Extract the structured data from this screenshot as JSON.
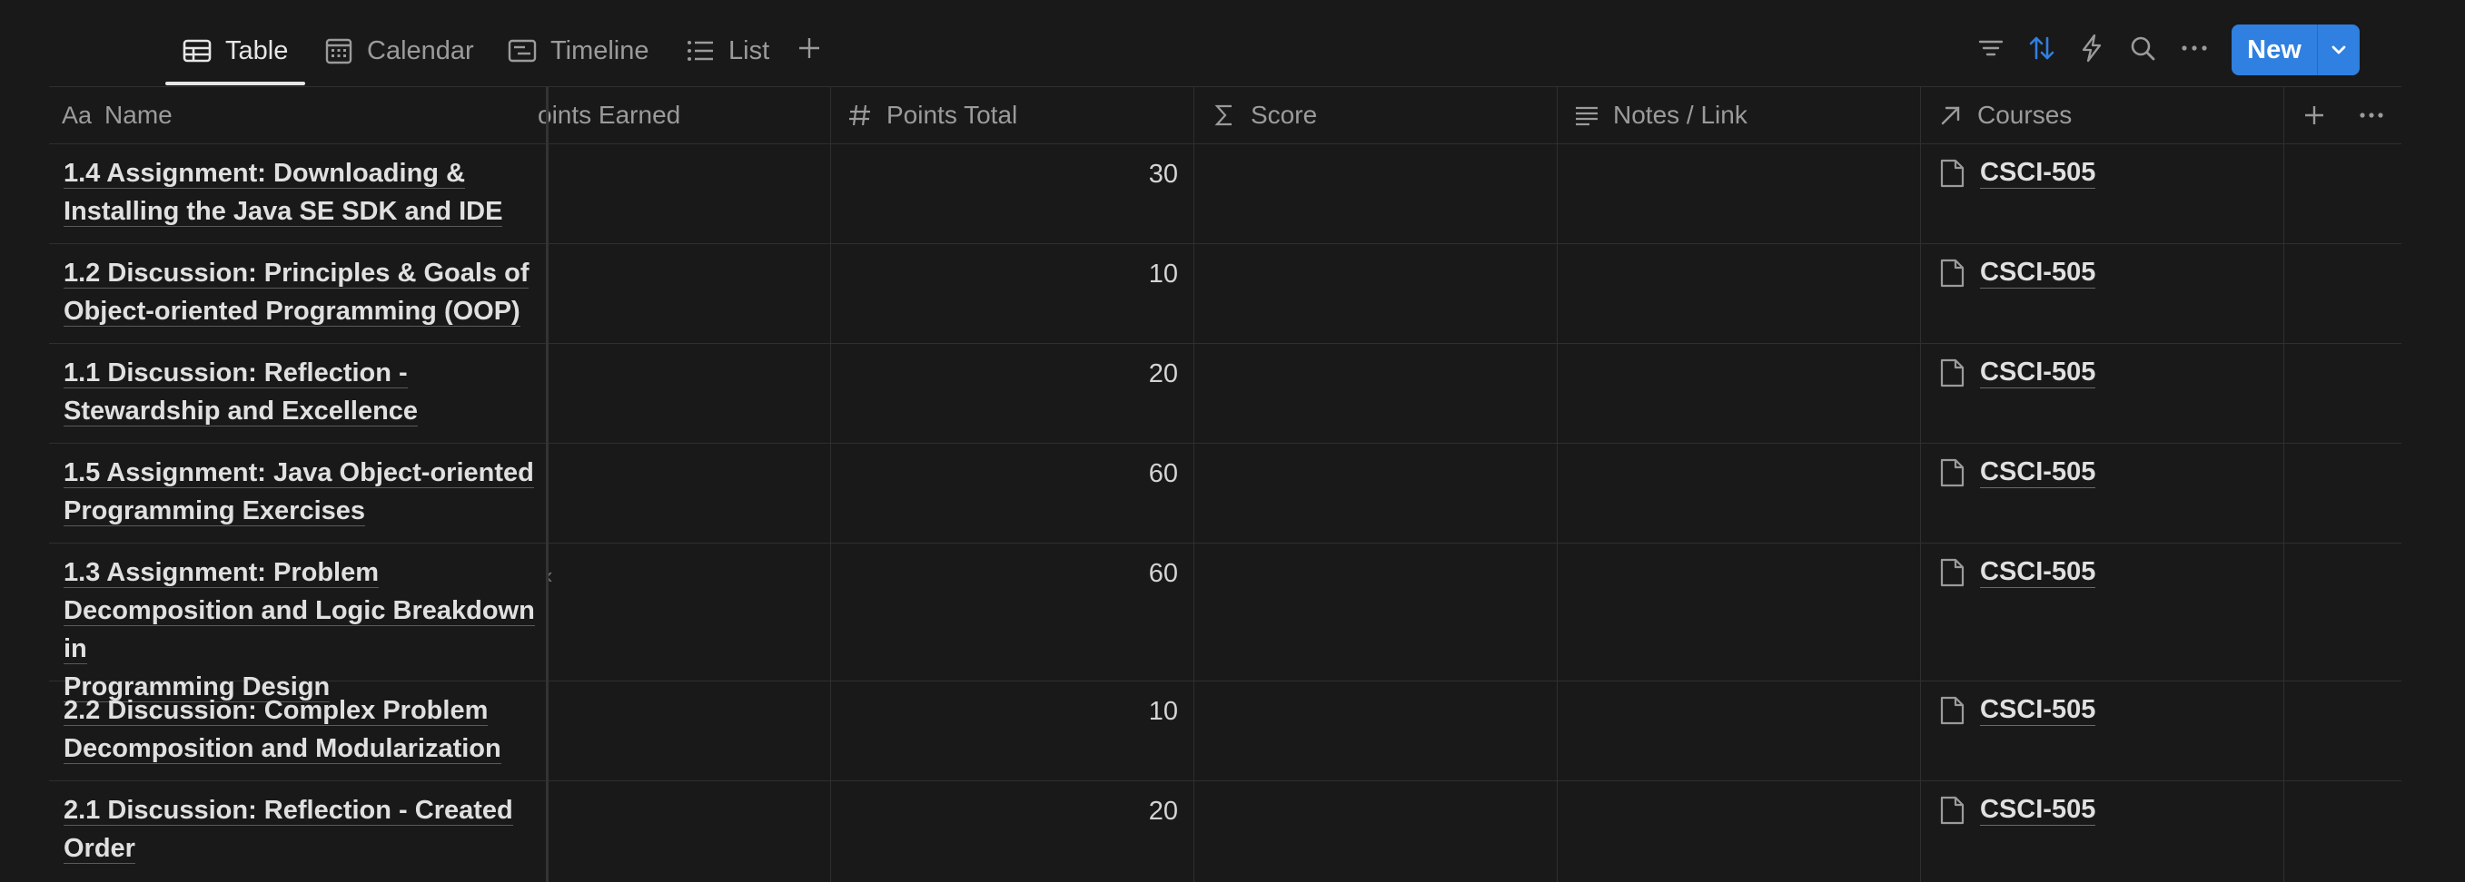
{
  "toolbar": {
    "tabs": [
      {
        "label": "Table",
        "icon": "table-icon",
        "active": true
      },
      {
        "label": "Calendar",
        "icon": "calendar-icon",
        "active": false
      },
      {
        "label": "Timeline",
        "icon": "timeline-icon",
        "active": false
      },
      {
        "label": "List",
        "icon": "list-icon",
        "active": false
      }
    ],
    "new_label": "New",
    "accent": "#2f80e0"
  },
  "columns": {
    "name": "Name",
    "name_icon_text": "Aa",
    "points_earned": "oints Earned",
    "points_total": "Points Total",
    "score": "Score",
    "notes": "Notes / Link",
    "courses": "Courses"
  },
  "rows": [
    {
      "name_lines": [
        "1.4 Assignment: Downloading &",
        "Installing the Java SE SDK and IDE"
      ],
      "points_total": "30",
      "course": "CSCI-505"
    },
    {
      "name_lines": [
        "1.2 Discussion: Principles & Goals of",
        "Object-oriented Programming (OOP)"
      ],
      "points_total": "10",
      "course": "CSCI-505"
    },
    {
      "name_lines": [
        "1.1 Discussion: Reflection -",
        "Stewardship and Excellence"
      ],
      "points_total": "20",
      "course": "CSCI-505"
    },
    {
      "name_lines": [
        "1.5 Assignment: Java Object-oriented",
        "Programming Exercises"
      ],
      "points_total": "60",
      "course": "CSCI-505"
    },
    {
      "name_lines": [
        "1.3 Assignment: Problem",
        "Decomposition and Logic Breakdown in",
        "Programming Design"
      ],
      "points_total": "60",
      "course": "CSCI-505"
    },
    {
      "name_lines": [
        "2.2 Discussion: Complex Problem",
        "Decomposition and Modularization"
      ],
      "points_total": "10",
      "course": "CSCI-505"
    },
    {
      "name_lines": [
        "2.1 Discussion: Reflection - Created",
        "Order"
      ],
      "points_total": "20",
      "course": "CSCI-505"
    }
  ]
}
